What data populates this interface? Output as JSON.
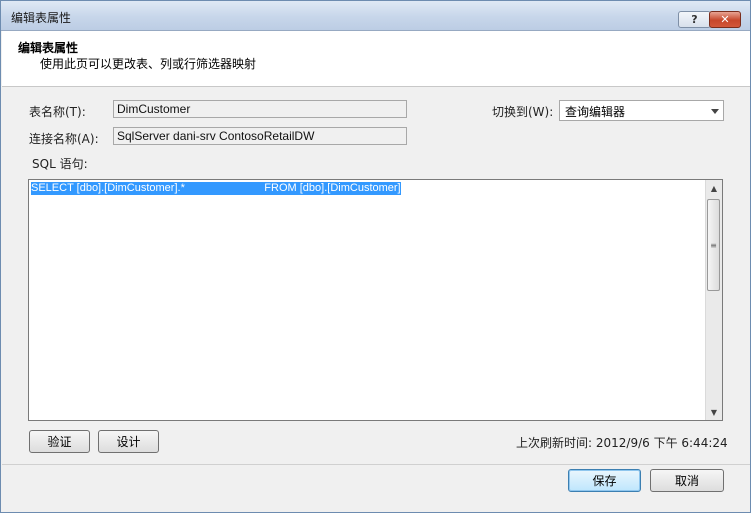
{
  "window": {
    "title": "编辑表属性",
    "help_label": "?",
    "close_label": "✕"
  },
  "header": {
    "heading": "编辑表属性",
    "subtitle": "使用此页可以更改表、列或行筛选器映射"
  },
  "form": {
    "table_name_label": "表名称(T):",
    "table_name_value": "DimCustomer",
    "connection_label": "连接名称(A):",
    "connection_value": "SqlServer dani-srv ContosoRetailDW",
    "switch_label": "切换到(W):",
    "switch_value": "查询编辑器",
    "sql_label": "SQL 语句:",
    "sql_text": "SELECT [dbo].[DimCustomer].*                          FROM [dbo].[DimCustomer]"
  },
  "actions": {
    "validate_label": "验证",
    "design_label": "设计",
    "last_refresh": "上次刷新时间: 2012/9/6 下午 6:44:24",
    "save_label": "保存",
    "cancel_label": "取消"
  },
  "icons": {
    "scroll_up": "▲",
    "scroll_down": "▼",
    "thumb_grip": "≡"
  }
}
